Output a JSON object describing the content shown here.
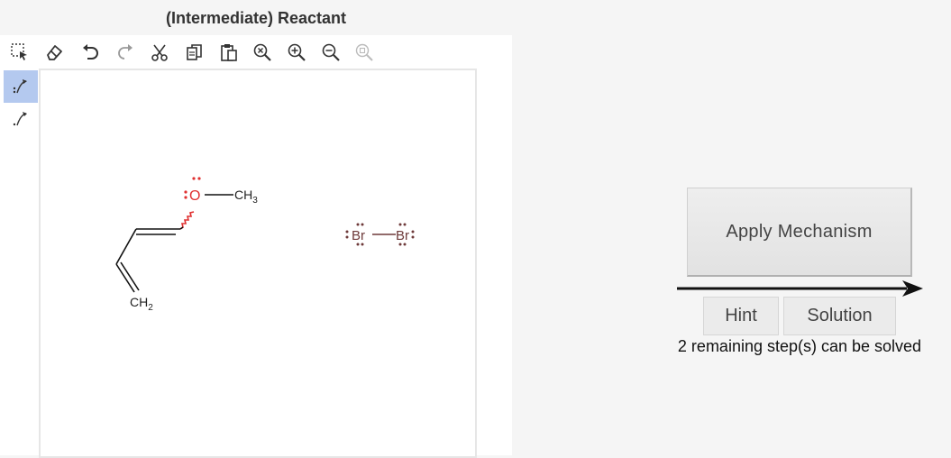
{
  "panel": {
    "title": "(Intermediate) Reactant"
  },
  "toolbar": {
    "tools": [
      "select-tool",
      "erase-tool",
      "undo",
      "redo",
      "cut",
      "copy",
      "paste",
      "zoom-reset",
      "zoom-in",
      "zoom-out",
      "zoom-fit"
    ]
  },
  "sidebar": {
    "tools": [
      "arrow-electron-pair",
      "arrow-single-electron"
    ],
    "active": "arrow-electron-pair"
  },
  "molecule": {
    "oxygen": "O",
    "methyl": "CH",
    "methyl_sub": "3",
    "methylene": "CH",
    "methylene_sub": "2",
    "bromine_left": "Br",
    "bromine_right": "Br"
  },
  "actions": {
    "apply_label": "Apply Mechanism",
    "hint_label": "Hint",
    "solution_label": "Solution",
    "status_text": "2 remaining step(s) can be solved"
  },
  "colors": {
    "oxygen": "#e03030",
    "bromine": "#6e3a3a",
    "bond": "#111111",
    "active_tool": "#b4c9ef"
  }
}
